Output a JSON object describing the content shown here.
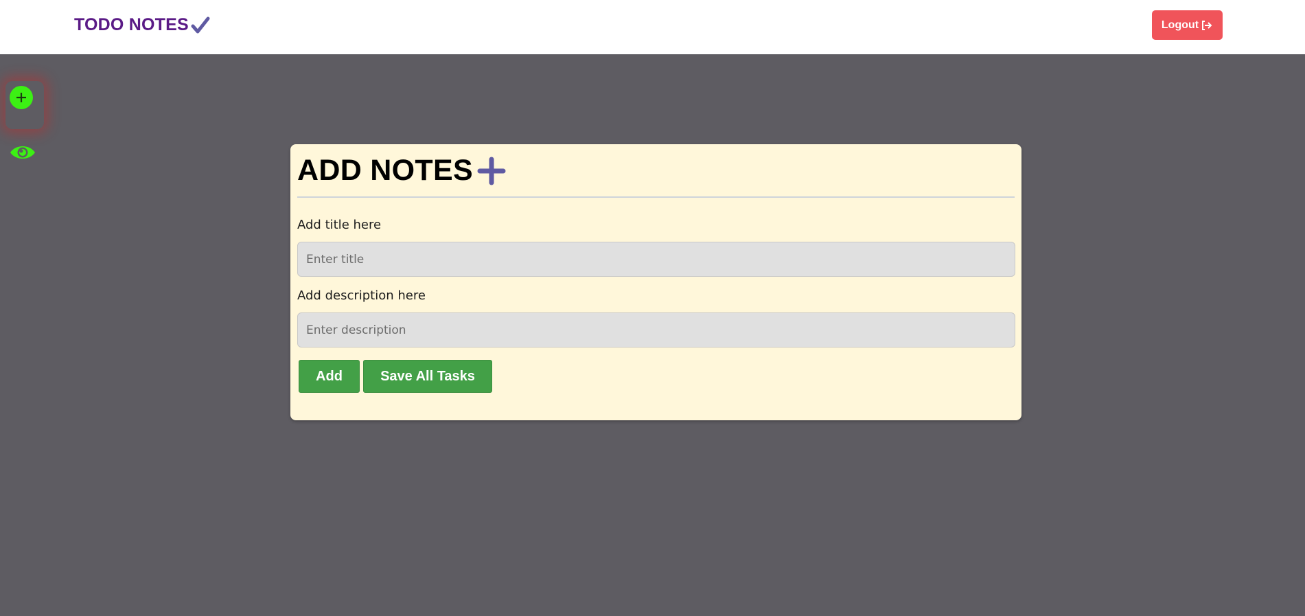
{
  "navbar": {
    "brand": "TODO NOTES",
    "brand_icon": "check-icon",
    "brand_color": "#5a1a86",
    "logout_label": "Logout",
    "logout_icon": "sign-out-icon",
    "logout_color": "#f0545a"
  },
  "sidebar": {
    "items": [
      {
        "icon": "plus-circle-icon",
        "color": "#3cf014"
      },
      {
        "icon": "eye-icon",
        "color": "#3cf014"
      }
    ]
  },
  "card": {
    "title": "ADD NOTES",
    "title_icon": "plus-icon",
    "title_label": "Add title here",
    "title_placeholder": "Enter title",
    "title_value": "",
    "description_label": "Add description here",
    "description_placeholder": "Enter description",
    "description_value": "",
    "add_label": "Add",
    "save_label": "Save All Tasks",
    "background": "#fff7da",
    "button_color": "#43a047"
  },
  "page": {
    "background": "#5e5c62"
  }
}
